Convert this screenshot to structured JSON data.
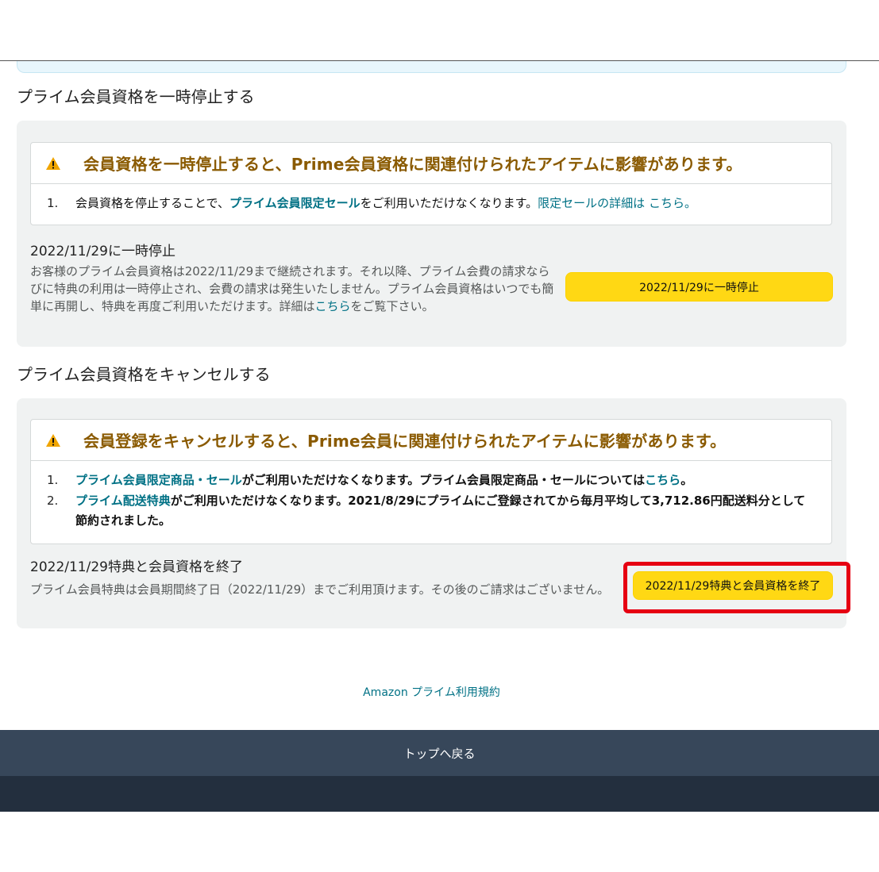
{
  "pause_section": {
    "title": "プライム会員資格を一時停止する",
    "alert_title": "会員資格を一時停止すると、Prime会員資格に関連付けられたアイテムに影響があります。",
    "items": [
      {
        "num": "1.",
        "pre": "会員資格を停止することで、",
        "link": "プライム会員限定セール",
        "mid": "をご利用いただけなくなります。",
        "post_link": "限定セールの詳細は こちら。"
      }
    ],
    "sub_title": "2022/11/29に一時停止",
    "desc_pre": "お客様のプライム会員資格は2022/11/29まで継続されます。それ以降、プライム会費の請求ならびに特典の利用は一時停止され、会費の請求は発生いたしません。プライム会員資格はいつでも簡単に再開し、特典を再度ご利用いただけます。詳細は",
    "desc_link": "こちら",
    "desc_post": "をご覧下さい。",
    "button_label": "2022/11/29に一時停止"
  },
  "cancel_section": {
    "title": "プライム会員資格をキャンセルする",
    "alert_title": "会員登録をキャンセルすると、Prime会員に関連付けられたアイテムに影響があります。",
    "items": [
      {
        "num": "1.",
        "link": "プライム会員限定商品・セール",
        "text": "がご利用いただけなくなります。プライム会員限定商品・セールについては",
        "link2": "こちら",
        "end": "。"
      },
      {
        "num": "2.",
        "link": "プライム配送特典",
        "text": "がご利用いただけなくなります。2021/8/29にプライムにご登録されてから毎月平均して3,712.86円配送料分として節約されました。"
      }
    ],
    "sub_title": "2022/11/29特典と会員資格を終了",
    "desc": "プライム会員特典は会員期間終了日（2022/11/29）までご利用頂けます。その後のご請求はございません。",
    "button_label": "2022/11/29特典と会員資格を終了"
  },
  "footer": {
    "terms_link": "Amazon プライム利用規約",
    "back_to_top": "トップへ戻る"
  },
  "colors": {
    "accent_yellow": "#ffd814",
    "link_teal": "#007185",
    "warning_title": "#8a5a00",
    "highlight_red": "#e60012"
  }
}
